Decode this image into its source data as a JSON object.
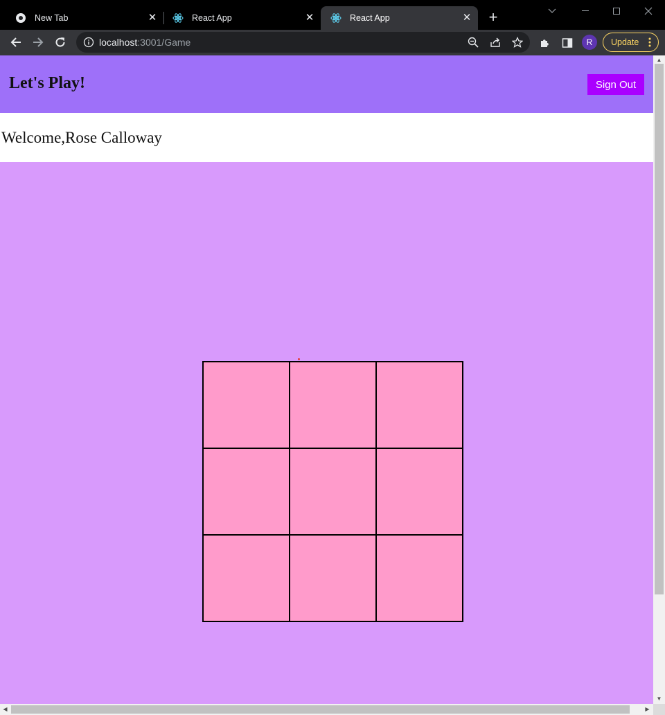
{
  "browser": {
    "tabs": [
      {
        "title": "New Tab",
        "favicon": "chrome-icon",
        "active": false
      },
      {
        "title": "React App",
        "favicon": "react-icon",
        "active": false
      },
      {
        "title": "React App",
        "favicon": "react-icon",
        "active": true
      }
    ],
    "address": {
      "host": "localhost",
      "path": ":3001/Game"
    },
    "profile_initial": "R",
    "update_label": "Update"
  },
  "app": {
    "title": "Let's Play!",
    "signout_label": "Sign Out",
    "welcome": "Welcome,Rose Calloway",
    "board": [
      "",
      "",
      "",
      "",
      "",
      "",
      "",
      "",
      ""
    ]
  },
  "colors": {
    "header": "#9e70f9",
    "page_bg": "#d89afc",
    "cell": "#ff9bcb",
    "signout": "#aa00ff"
  }
}
